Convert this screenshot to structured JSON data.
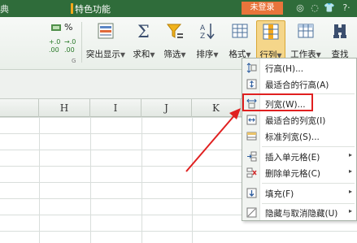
{
  "titlebar": {
    "partial_tab": "典",
    "feature_tab": "特色功能",
    "login": "未登录",
    "icons": [
      "circle-icon",
      "settings-icon",
      "shirt-icon",
      "help-icon"
    ],
    "help": "?·"
  },
  "ribbon": {
    "left_symbol": "%",
    "left_decimals_1": ".00",
    "left_decimals_2": ".00",
    "left_decimals_arrows_1": "+.0",
    "left_decimals_arrows_2": "→.0",
    "group_tag": "G",
    "buttons": [
      {
        "label": "突出显示",
        "icon": "highlight-icon"
      },
      {
        "label": "求和",
        "icon": "sigma-icon"
      },
      {
        "label": "筛选",
        "icon": "filter-icon"
      },
      {
        "label": "排序",
        "icon": "sort-icon"
      },
      {
        "label": "格式",
        "icon": "format-icon"
      },
      {
        "label": "行列",
        "icon": "row-col-icon"
      },
      {
        "label": "工作表",
        "icon": "worksheet-icon"
      },
      {
        "label": "查找",
        "icon": "find-icon"
      }
    ],
    "dropdown_arrow": "▼"
  },
  "sheet": {
    "columns": [
      "H",
      "I",
      "J",
      "K"
    ]
  },
  "menu": {
    "items": [
      {
        "label": "行高(H)...",
        "icon": "row-height-icon"
      },
      {
        "label": "最适合的行高(A)",
        "icon": "autofit-row-icon"
      },
      {
        "label": "列宽(W)...",
        "icon": "column-width-icon"
      },
      {
        "label": "最适合的列宽(I)",
        "icon": "autofit-column-icon"
      },
      {
        "label": "标准列宽(S)...",
        "icon": "standard-width-icon"
      },
      {
        "label": "插入单元格(E)",
        "icon": "insert-cell-icon"
      },
      {
        "label": "删除单元格(C)",
        "icon": "delete-cell-icon"
      },
      {
        "label": "填充(F)",
        "icon": "fill-icon"
      },
      {
        "label": "隐藏与取消隐藏(U)",
        "icon": "hide-unhide-icon"
      }
    ],
    "submenu_arrow": "▸"
  },
  "colors": {
    "titlebar": "#2f6c3a",
    "login": "#e8743b",
    "highlight": "#e02020",
    "active_button": "#f5d68a"
  }
}
